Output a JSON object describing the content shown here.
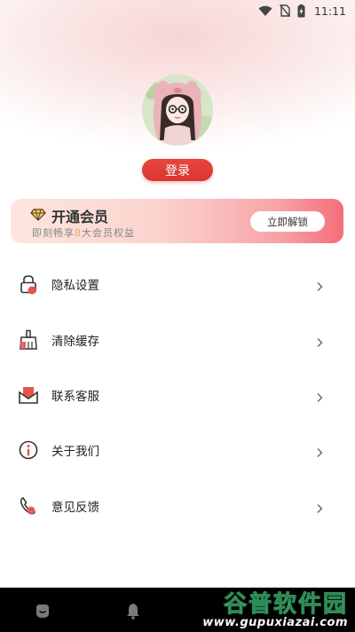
{
  "status_bar": {
    "time": "11:11",
    "icons": [
      "wifi-icon",
      "no-sim-icon",
      "battery-charging-icon"
    ]
  },
  "profile": {
    "avatar": "cartoon-girl-avatar",
    "login_label": "登录"
  },
  "vip": {
    "title": "开通会员",
    "subtitle_prefix": "即刻畅享",
    "subtitle_highlight": "8",
    "subtitle_suffix": "大会员权益",
    "button_label": "立即解锁",
    "icon": "diamond-icon"
  },
  "menu": {
    "items": [
      {
        "label": "隐私设置",
        "icon": "lock-icon"
      },
      {
        "label": "清除缓存",
        "icon": "broom-icon"
      },
      {
        "label": "联系客服",
        "icon": "mail-icon"
      },
      {
        "label": "关于我们",
        "icon": "info-icon"
      },
      {
        "label": "意见反馈",
        "icon": "phone-icon"
      }
    ]
  },
  "bottom_nav": {
    "icons": [
      "home-icon",
      "bell-icon"
    ]
  },
  "watermark": {
    "title": "谷普软件园",
    "url": "www.gupuxiazai.com"
  },
  "colors": {
    "accent_red": "#e0403a",
    "icon_red": "#e8534d",
    "vip_highlight": "#e8a86a"
  }
}
